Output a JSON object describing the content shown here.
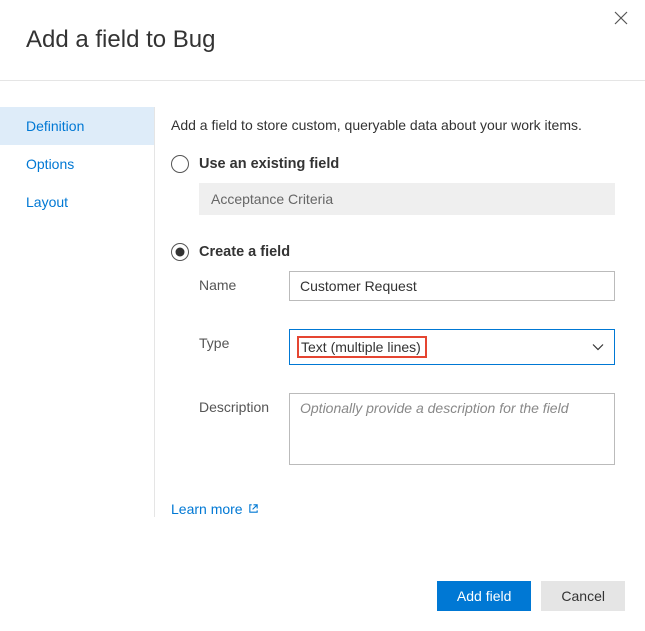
{
  "dialog": {
    "title": "Add a field to Bug"
  },
  "sidebar": {
    "items": [
      {
        "label": "Definition",
        "active": true
      },
      {
        "label": "Options",
        "active": false
      },
      {
        "label": "Layout",
        "active": false
      }
    ]
  },
  "main": {
    "intro": "Add a field to store custom, queryable data about your work items.",
    "existing": {
      "label": "Use an existing field",
      "value": "Acceptance Criteria"
    },
    "create": {
      "label": "Create a field",
      "name_label": "Name",
      "name_value": "Customer Request",
      "type_label": "Type",
      "type_value": "Text (multiple lines)",
      "description_label": "Description",
      "description_placeholder": "Optionally provide a description for the field"
    },
    "learn_more": "Learn more"
  },
  "footer": {
    "primary": "Add field",
    "secondary": "Cancel"
  }
}
